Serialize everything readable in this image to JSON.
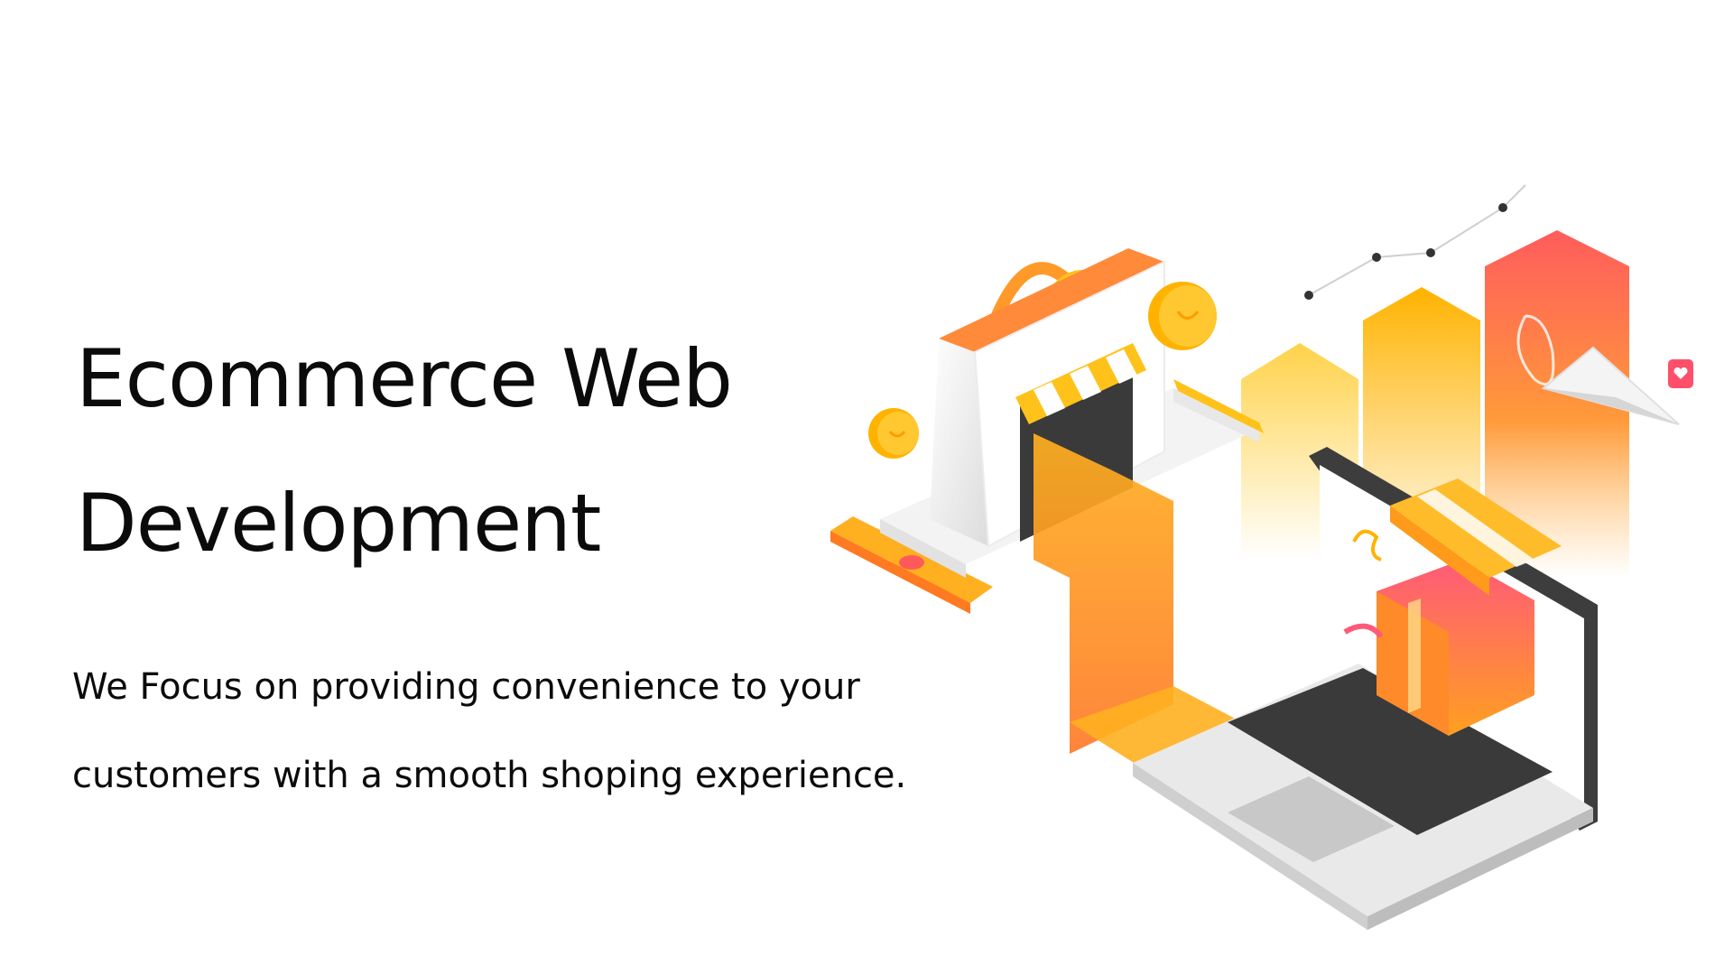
{
  "hero": {
    "title_line1": "Ecommerce Web",
    "title_line2": "Development",
    "description_line1": "We Focus on providing convenience to your",
    "description_line2": "customers with a smooth shoping experience."
  },
  "illustration": {
    "icons": [
      "shopping-bag-icon",
      "storefront-awning-icon",
      "coin-icon",
      "credit-card-icon",
      "bar-chart-icon",
      "line-graph-icon",
      "paper-plane-icon",
      "heart-chat-icon",
      "laptop-icon",
      "gift-box-icon"
    ]
  },
  "colors": {
    "text": "#0b0b0b",
    "accent_yellow": "#ffc21a",
    "accent_orange": "#ff8a2a",
    "accent_coral": "#ff5a6a",
    "laptop_gray": "#e6e6e6",
    "keyboard": "#3a3a3a"
  }
}
